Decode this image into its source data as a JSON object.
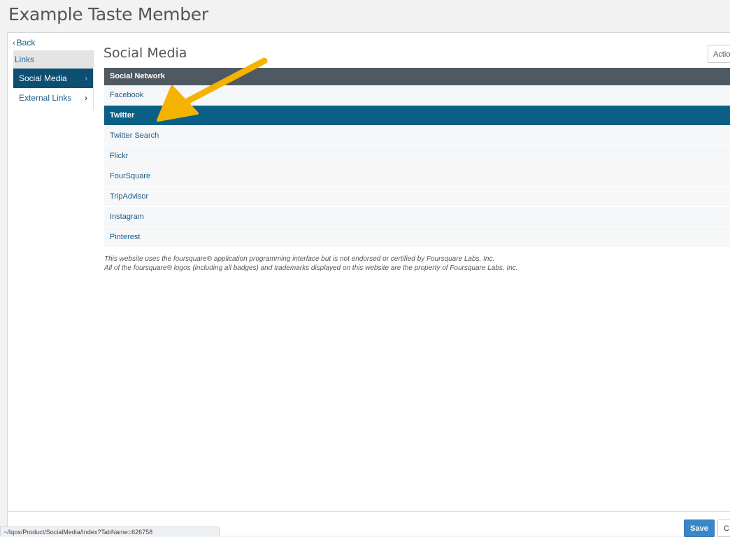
{
  "page": {
    "title": "Example Taste Member"
  },
  "nav": {
    "back_label": "Back",
    "sidebar_header": "Links",
    "items": [
      {
        "label": "Social Media",
        "active": true
      },
      {
        "label": "External Links",
        "active": false
      }
    ]
  },
  "main": {
    "section_title": "Social Media",
    "actions_label": "Actio",
    "table": {
      "column_header": "Social Network",
      "rows": [
        "Facebook",
        "Twitter",
        "Twitter Search",
        "Flickr",
        "FourSquare",
        "TripAdvisor",
        "Instagram",
        "Pinterest"
      ],
      "selected_row": "Twitter"
    },
    "footnote": [
      "This website uses the foursquare® application programming interface but is not endorsed or certified by Foursquare Labs, Inc.",
      "All of the foursquare® logos (including all badges) and trademarks displayed on this website are the property of Foursquare Labs, Inc."
    ]
  },
  "footer": {
    "save_label": "Save",
    "cancel_label": "C",
    "status_url": "~/Iqos/Product/SocialMedia/Index?TabName=626758"
  },
  "colors": {
    "active_nav": "#0d4f72",
    "table_header": "#4f5962",
    "selected_row": "#0a5f86",
    "annotation_arrow": "#f5b301",
    "save_button": "#3a86c8"
  }
}
